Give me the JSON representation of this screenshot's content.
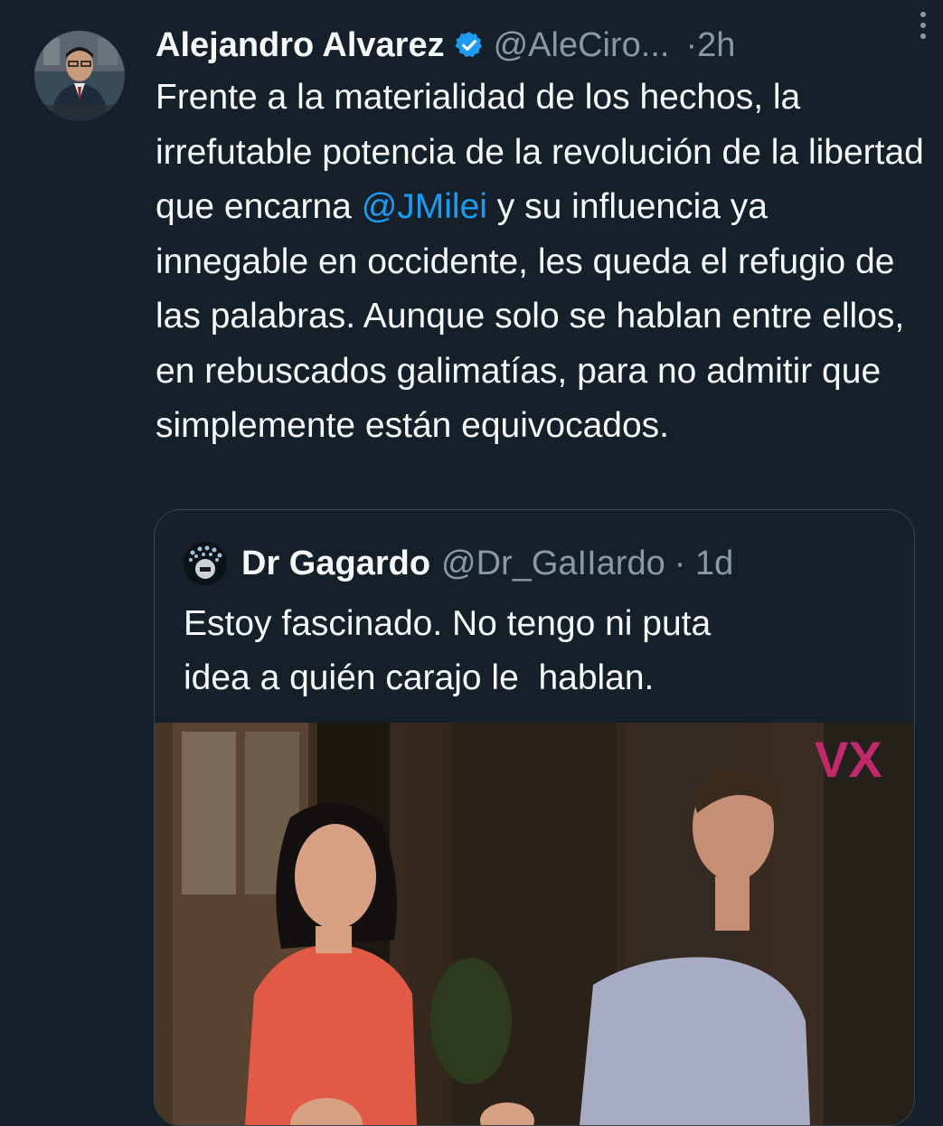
{
  "tweet": {
    "author_name": "Alejandro Alvarez",
    "handle": "@AleCiro...",
    "separator": "·",
    "time": "2h",
    "text_parts": [
      "Frente a la materialidad de los hechos, la irrefutable potencia de la revolución de la libertad que encarna ",
      "@JMilei",
      " y su influencia ya innegable en occidente, les queda el refugio de las palabras. Aunque solo se hablan entre ellos, en rebuscados galimatías, para no admitir que simplemente están equivocados."
    ]
  },
  "quote": {
    "author_name": "Dr Gagardo",
    "handle": "@Dr_GaIIardo",
    "separator": "·",
    "time": "1d",
    "text": "Estoy fascinado. No tengo ni puta\nidea a quién carajo le  hablan."
  },
  "media": {
    "watermark": "VX",
    "description_icon": "video-thumbnail"
  },
  "colors": {
    "background": "#15202b",
    "text_primary": "#f7f9f9",
    "text_secondary": "#8b98a5",
    "link": "#1d9bf0",
    "verified": "#1d9bf0",
    "border": "#38444d"
  },
  "icons": [
    "verified-badge-icon",
    "more-options-icon"
  ]
}
